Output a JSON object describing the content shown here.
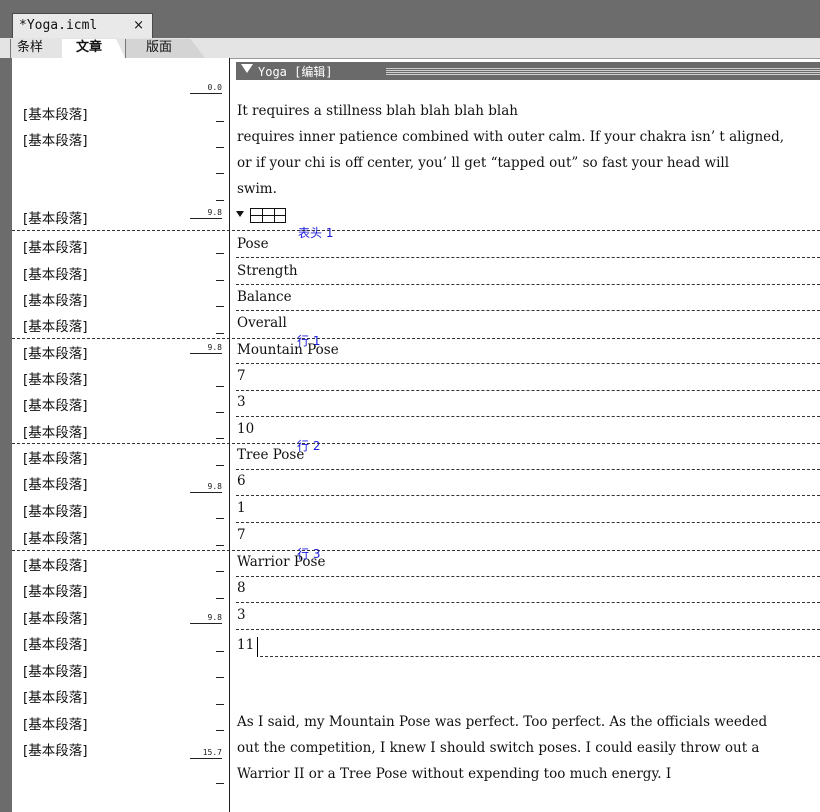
{
  "document_tab": {
    "title": "*Yoga.icml",
    "close_label": "×"
  },
  "view_tabs": [
    "条样",
    "文章",
    "版面"
  ],
  "style_column": {
    "paragraph_styles": [
      "[基本段落]",
      "[基本段落]",
      "[基本段落]",
      "[基本段落]",
      "[基本段落]",
      "[基本段落]",
      "[基本段落]",
      "[基本段落]",
      "[基本段落]",
      "[基本段落]",
      "[基本段落]",
      "[基本段落]",
      "[基本段落]",
      "[基本段落]",
      "[基本段落]",
      "[基本段落]",
      "[基本段落]",
      "[基本段落]",
      "[基本段落]",
      "[基本段落]",
      "[基本段落]",
      "[基本段落]",
      "[基本段落]"
    ],
    "depth_ruler": [
      "0.0",
      "9.8",
      "9.8",
      "9.8",
      "9.8",
      "15.7"
    ]
  },
  "story_header": {
    "title": "Yoga [编辑]"
  },
  "body_text": {
    "intro_lines": [
      "It requires a stillness blah blah blah blah",
      "requires inner patience combined with outer calm. If your chakra isn’ t aligned,",
      "or if your chi is off center, you’ ll get  “tapped out”  so fast your head will",
      "swim."
    ],
    "closing_lines": [
      "As I said, my Mountain Pose was perfect. Too perfect. As the officials weeded",
      "out the competition, I knew I should switch poses. I could easily throw out a",
      "Warrior II or a Tree Pose without expending too much energy. I"
    ]
  },
  "table": {
    "cells": [
      "Pose",
      "Strength",
      "Balance",
      "Overall",
      "Mountain Pose",
      "7",
      "3",
      "10",
      "Tree Pose",
      "6",
      "1",
      "7",
      "Warrior Pose",
      "8",
      "3",
      "11"
    ],
    "row_labels": {
      "header": "表头 1",
      "row1": "行 1",
      "row2": "行 2",
      "row3": "行 3"
    }
  }
}
